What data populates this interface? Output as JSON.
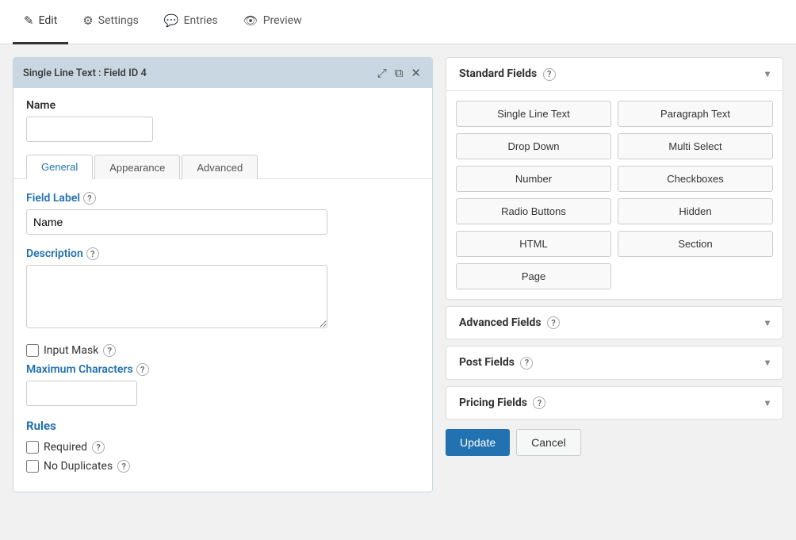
{
  "nav": {
    "tabs": [
      {
        "id": "edit",
        "label": "Edit",
        "icon": "✎",
        "active": true
      },
      {
        "id": "settings",
        "label": "Settings",
        "icon": "⚙"
      },
      {
        "id": "entries",
        "label": "Entries",
        "icon": "💬"
      },
      {
        "id": "preview",
        "label": "Preview",
        "icon": "👁"
      }
    ]
  },
  "fieldEditor": {
    "headerTitle": "Single Line Text : Field ID 4",
    "nameLabel": "Name",
    "nameInputValue": "",
    "nameInputPlaceholder": "",
    "tabs": [
      {
        "id": "general",
        "label": "General",
        "active": true
      },
      {
        "id": "appearance",
        "label": "Appearance",
        "active": false
      },
      {
        "id": "advanced",
        "label": "Advanced",
        "active": false
      }
    ],
    "fieldLabelLabel": "Field Label",
    "fieldLabelHelp": "?",
    "fieldLabelValue": "Name",
    "descriptionLabel": "Description",
    "descriptionHelp": "?",
    "descriptionValue": "",
    "inputMaskLabel": "Input Mask",
    "inputMaskHelp": "?",
    "maxCharsLabel": "Maximum Characters",
    "maxCharsHelp": "?",
    "maxCharsValue": "",
    "rulesLabel": "Rules",
    "requiredLabel": "Required",
    "requiredHelp": "?",
    "noDuplicatesLabel": "No Duplicates",
    "noDuplicatesHelp": "?"
  },
  "standardFields": {
    "title": "Standard Fields",
    "help": "?",
    "buttons": [
      "Single Line Text",
      "Paragraph Text",
      "Drop Down",
      "Multi Select",
      "Number",
      "Checkboxes",
      "Radio Buttons",
      "Hidden",
      "HTML",
      "Section",
      "Page"
    ]
  },
  "advancedFields": {
    "title": "Advanced Fields",
    "help": "?"
  },
  "postFields": {
    "title": "Post Fields",
    "help": "?"
  },
  "pricingFields": {
    "title": "Pricing Fields",
    "help": "?"
  },
  "actions": {
    "updateLabel": "Update",
    "cancelLabel": "Cancel"
  }
}
